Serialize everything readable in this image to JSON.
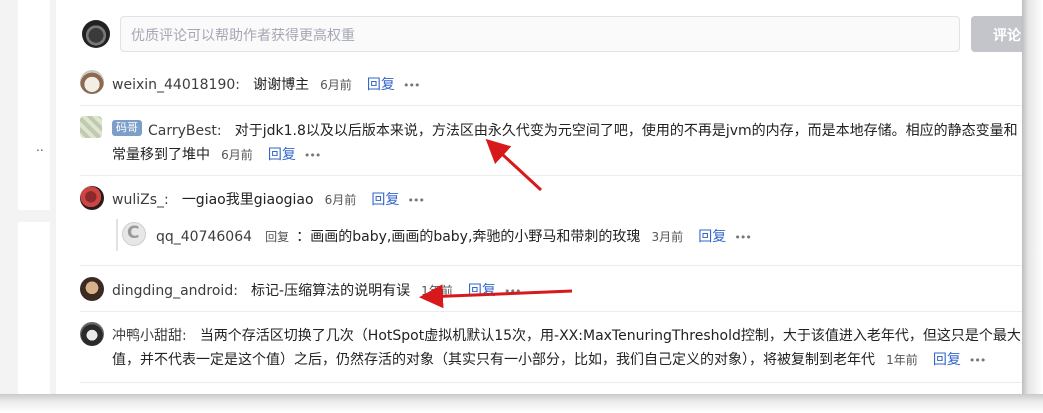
{
  "comment_box": {
    "placeholder": "优质评论可以帮助作者获得更高权重",
    "submit_label": "评论"
  },
  "left_col": {
    "ellipsis": ".."
  },
  "comments": [
    {
      "user": "weixin_44018190:",
      "text": "谢谢博主",
      "time": "6月前",
      "reply": "回复",
      "more": "•••"
    },
    {
      "badge": "码哥",
      "user": "CarryBest:",
      "text_line1": "对于jdk1.8以及以后版本来说，方法区由永久代变为元空间了吧，使用的不再是jvm的内存，而是本地存储。相应的静态变量和",
      "text_line2": "常量移到了堆中",
      "time": "6月前",
      "reply": "回复",
      "more": "•••"
    },
    {
      "user": "wuliZs_:",
      "text": "一giao我里giaogiao",
      "time": "6月前",
      "reply": "回复",
      "more": "•••"
    },
    {
      "user": "qq_40746064",
      "reply_prefix": "回复",
      "text": "：画画的baby,画画的baby,奔驰的小野马和带刺的玫瑰",
      "time": "3月前",
      "reply": "回复",
      "more": "•••",
      "avatar_letter": "C"
    },
    {
      "user": "dingding_android:",
      "text": "标记-压缩算法的说明有误",
      "time": "1年前",
      "reply": "回复",
      "more": "•••"
    },
    {
      "user": "冲鸭小甜甜:",
      "text_line1": "当两个存活区切换了几次（HotSpot虚拟机默认15次，用-XX:MaxTenuringThreshold控制，大于该值进入老年代，但这只是个最大",
      "text_line2": "值，并不代表一定是这个值）之后，仍然存活的对象（其实只有一小部分，比如，我们自己定义的对象），将被复制到老年代",
      "time": "1年前",
      "reply": "回复",
      "more": "•••"
    }
  ],
  "colors": {
    "reply_link": "#3366cc",
    "arrow": "#d7191c",
    "badge": "#7c9ec8"
  }
}
